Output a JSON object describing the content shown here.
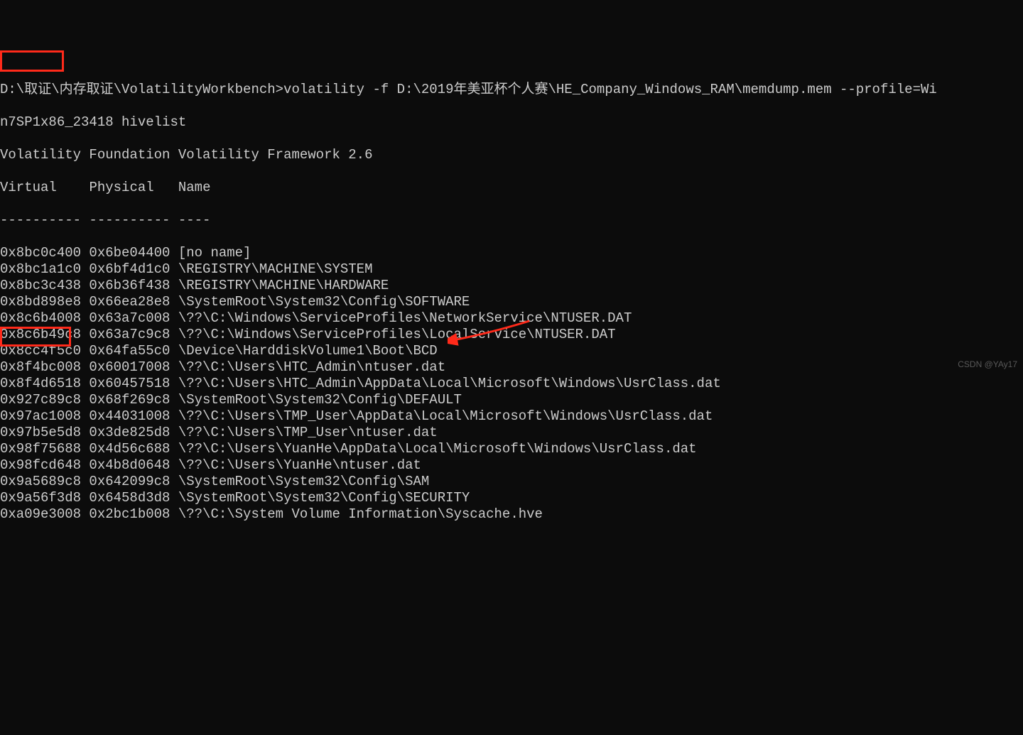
{
  "command_line1": "D:\\取证\\内存取证\\VolatilityWorkbench>volatility -f D:\\2019年美亚杯个人赛\\HE_Company_Windows_RAM\\memdump.mem --profile=Wi",
  "command_line2": "n7SP1x86_23418 hivelist",
  "banner": "Volatility Foundation Volatility Framework 2.6",
  "headers": {
    "virtual": "Virtual",
    "physical": "Physical",
    "name": "Name"
  },
  "separator": "---------- ---------- ----",
  "rows": [
    {
      "virtual": "0x8bc0c400",
      "physical": "0x6be04400",
      "name": "[no name]"
    },
    {
      "virtual": "0x8bc1a1c0",
      "physical": "0x6bf4d1c0",
      "name": "\\REGISTRY\\MACHINE\\SYSTEM"
    },
    {
      "virtual": "0x8bc3c438",
      "physical": "0x6b36f438",
      "name": "\\REGISTRY\\MACHINE\\HARDWARE"
    },
    {
      "virtual": "0x8bd898e8",
      "physical": "0x66ea28e8",
      "name": "\\SystemRoot\\System32\\Config\\SOFTWARE"
    },
    {
      "virtual": "0x8c6b4008",
      "physical": "0x63a7c008",
      "name": "\\??\\C:\\Windows\\ServiceProfiles\\NetworkService\\NTUSER.DAT"
    },
    {
      "virtual": "0x8c6b49c8",
      "physical": "0x63a7c9c8",
      "name": "\\??\\C:\\Windows\\ServiceProfiles\\LocalService\\NTUSER.DAT"
    },
    {
      "virtual": "0x8cc4f5c0",
      "physical": "0x64fa55c0",
      "name": "\\Device\\HarddiskVolume1\\Boot\\BCD"
    },
    {
      "virtual": "0x8f4bc008",
      "physical": "0x60017008",
      "name": "\\??\\C:\\Users\\HTC_Admin\\ntuser.dat"
    },
    {
      "virtual": "0x8f4d6518",
      "physical": "0x60457518",
      "name": "\\??\\C:\\Users\\HTC_Admin\\AppData\\Local\\Microsoft\\Windows\\UsrClass.dat"
    },
    {
      "virtual": "0x927c89c8",
      "physical": "0x68f269c8",
      "name": "\\SystemRoot\\System32\\Config\\DEFAULT"
    },
    {
      "virtual": "0x97ac1008",
      "physical": "0x44031008",
      "name": "\\??\\C:\\Users\\TMP_User\\AppData\\Local\\Microsoft\\Windows\\UsrClass.dat"
    },
    {
      "virtual": "0x97b5e5d8",
      "physical": "0x3de825d8",
      "name": "\\??\\C:\\Users\\TMP_User\\ntuser.dat"
    },
    {
      "virtual": "0x98f75688",
      "physical": "0x4d56c688",
      "name": "\\??\\C:\\Users\\YuanHe\\AppData\\Local\\Microsoft\\Windows\\UsrClass.dat"
    },
    {
      "virtual": "0x98fcd648",
      "physical": "0x4b8d0648",
      "name": "\\??\\C:\\Users\\YuanHe\\ntuser.dat"
    },
    {
      "virtual": "0x9a5689c8",
      "physical": "0x642099c8",
      "name": "\\SystemRoot\\System32\\Config\\SAM"
    },
    {
      "virtual": "0x9a56f3d8",
      "physical": "0x6458d3d8",
      "name": "\\SystemRoot\\System32\\Config\\SECURITY"
    },
    {
      "virtual": "0xa09e3008",
      "physical": "0x2bc1b008",
      "name": "\\??\\C:\\System Volume Information\\Syscache.hve"
    }
  ],
  "highlight_box1_label": "virtual-header-highlight",
  "highlight_box2_label": "sam-virtual-highlight",
  "arrow_label": "arrow-annotation",
  "watermark": "CSDN @YAy17"
}
